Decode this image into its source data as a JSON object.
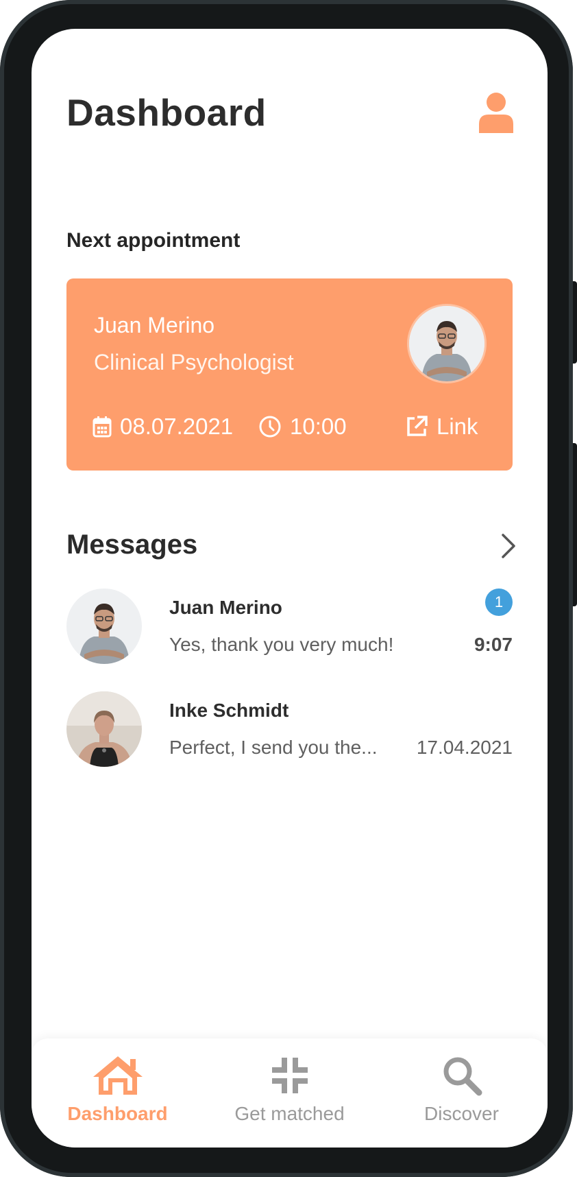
{
  "header": {
    "title": "Dashboard",
    "profile_icon": "user-icon"
  },
  "colors": {
    "accent": "#fe9e6c",
    "badge": "#43a0dc",
    "text": "#2d2d2d",
    "muted": "#9a9a9a"
  },
  "next_appointment": {
    "section_label": "Next appointment",
    "name": "Juan Merino",
    "role": "Clinical Psychologist",
    "date": "08.07.2021",
    "time": "10:00",
    "link_label": "Link",
    "icons": [
      "calendar-icon",
      "clock-icon",
      "external-link-icon"
    ]
  },
  "messages": {
    "title": "Messages",
    "items": [
      {
        "name": "Juan Merino",
        "preview": "Yes, thank you very much!",
        "time": "9:07",
        "unread": "1"
      },
      {
        "name": "Inke Schmidt",
        "preview": "Perfect, I send you the...",
        "time": "17.04.2021"
      }
    ]
  },
  "tabbar": {
    "tabs": [
      {
        "label": "Dashboard",
        "icon": "home-icon",
        "active": true
      },
      {
        "label": "Get matched",
        "icon": "match-icon",
        "active": false
      },
      {
        "label": "Discover",
        "icon": "search-icon",
        "active": false
      }
    ]
  }
}
